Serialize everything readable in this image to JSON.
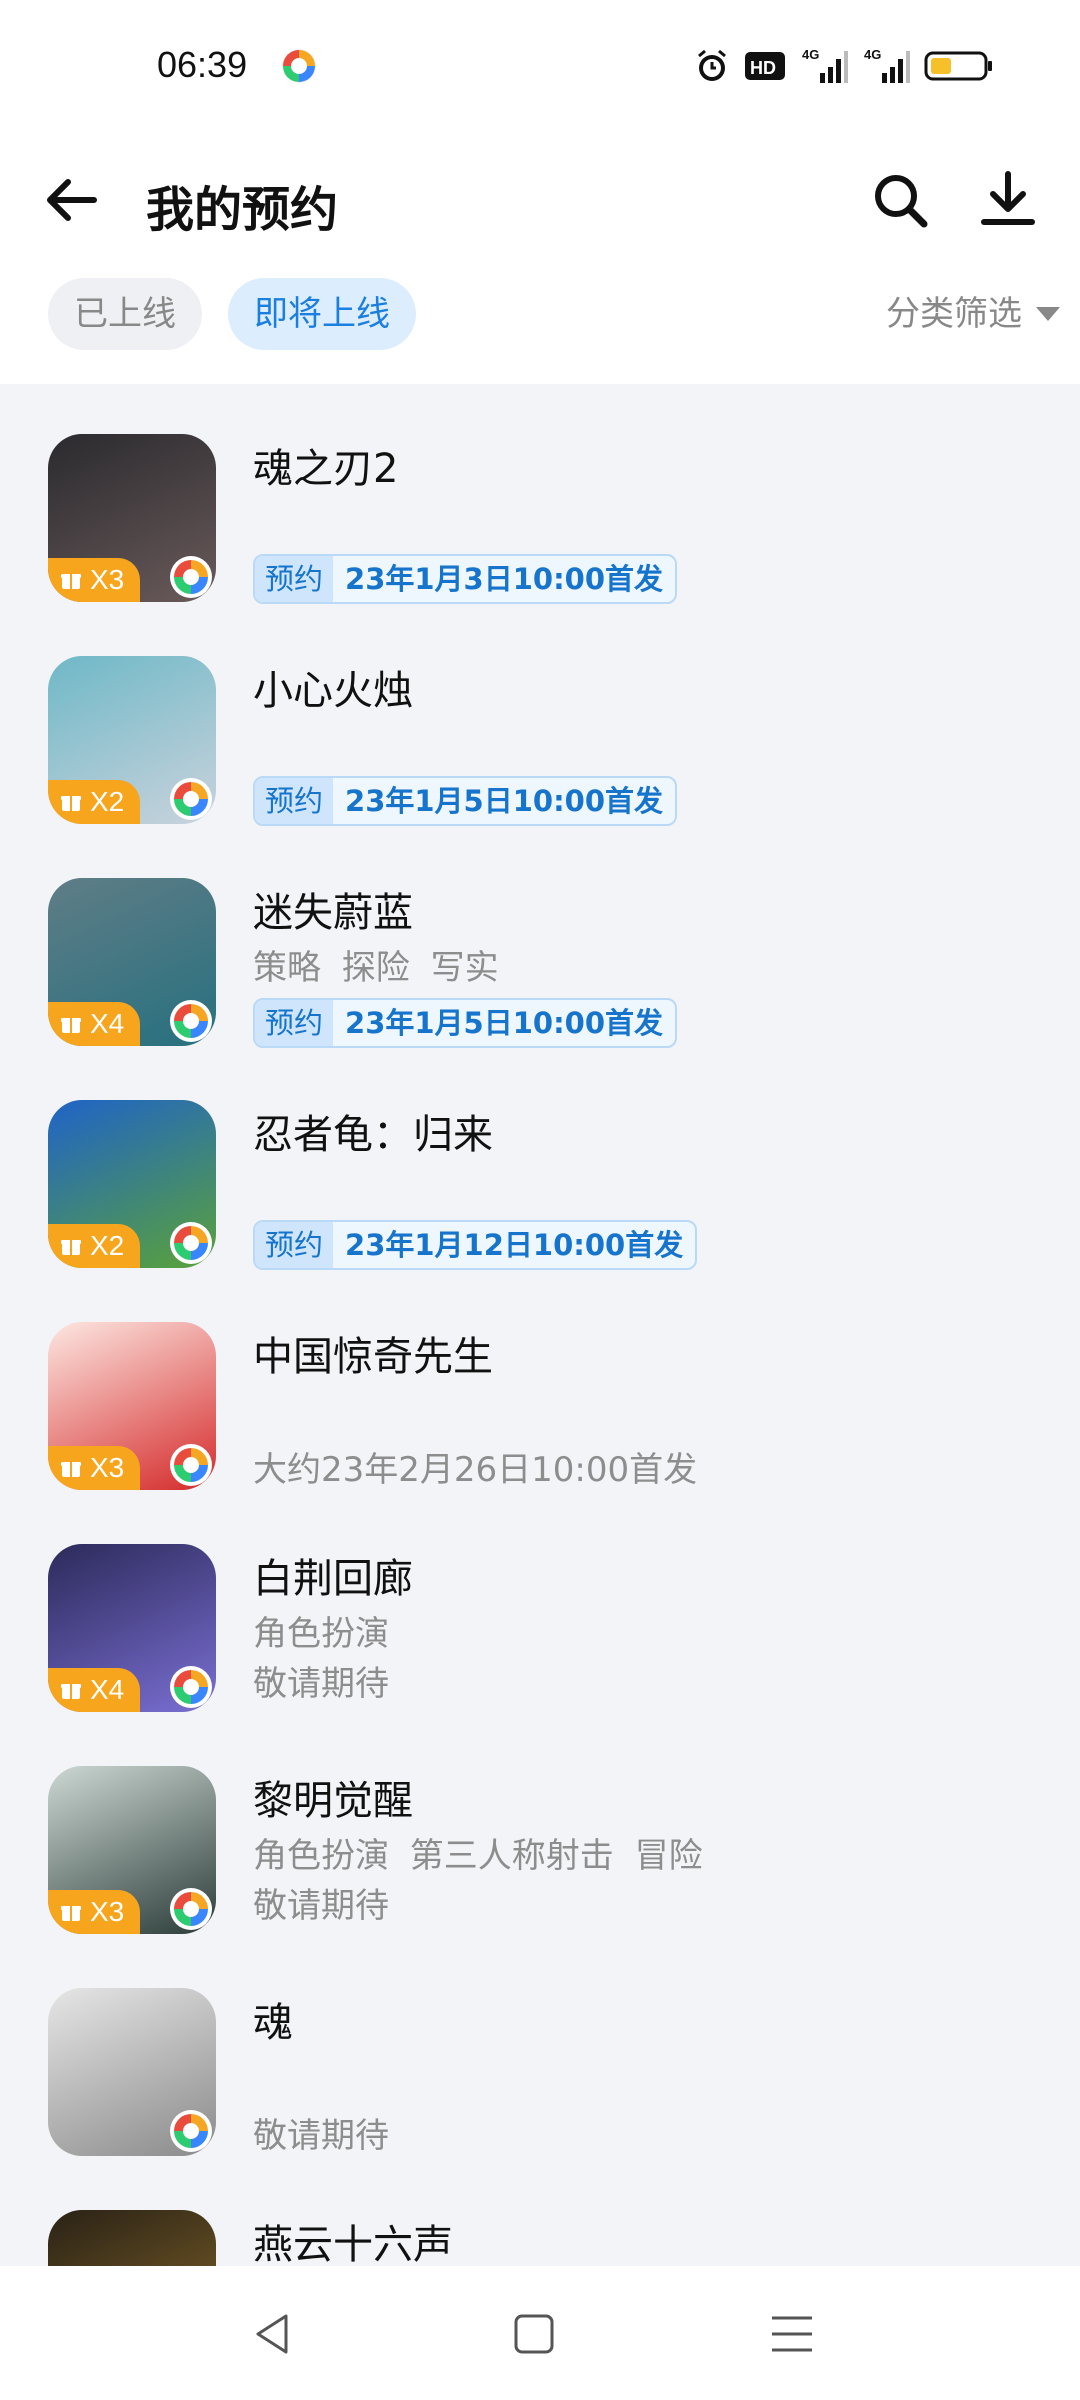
{
  "status_bar": {
    "time": "06:39",
    "icons": [
      "alarm-icon",
      "hd-icon",
      "4g-signal-icon",
      "4g-signal-icon",
      "battery-icon"
    ],
    "signal_labels": [
      "4G",
      "4G"
    ],
    "hd_label": "HD"
  },
  "header": {
    "title": "我的预约",
    "back_icon": "back-arrow-icon",
    "search_icon": "search-icon",
    "download_icon": "download-icon"
  },
  "tabs": [
    {
      "label": "已上线",
      "active": false
    },
    {
      "label": "即将上线",
      "active": true
    }
  ],
  "filter": {
    "label": "分类筛选",
    "icon": "triangle-down-icon"
  },
  "games": [
    {
      "name": "魂之刃2",
      "gift": "X3",
      "tags": "",
      "release_tag": "预约",
      "release_date": "23年1月3日10:00首发",
      "release_text": "",
      "colors": [
        "#2a2a2e",
        "#6a5a5a"
      ]
    },
    {
      "name": "小心火烛",
      "gift": "X2",
      "tags": "",
      "release_tag": "预约",
      "release_date": "23年1月5日10:00首发",
      "release_text": "",
      "colors": [
        "#6fb8c7",
        "#c9d3dc"
      ]
    },
    {
      "name": "迷失蔚蓝",
      "gift": "X4",
      "tags": "策略 探险 写实",
      "release_tag": "预约",
      "release_date": "23年1月5日10:00首发",
      "release_text": "",
      "colors": [
        "#5f7d86",
        "#27707f"
      ]
    },
    {
      "name": "忍者龟：归来",
      "gift": "X2",
      "tags": "",
      "release_tag": "预约",
      "release_date": "23年1月12日10:00首发",
      "release_text": "",
      "colors": [
        "#1f63c8",
        "#5aa23a"
      ]
    },
    {
      "name": "中国惊奇先生",
      "gift": "X3",
      "tags": "",
      "release_tag": "",
      "release_date": "",
      "release_text": "大约23年2月26日10:00首发",
      "colors": [
        "#fde7e2",
        "#d42a2a"
      ]
    },
    {
      "name": "白荆回廊",
      "gift": "X4",
      "tags": "角色扮演",
      "release_tag": "",
      "release_date": "",
      "release_text": "敬请期待",
      "colors": [
        "#2c2a5a",
        "#7a6fd3"
      ]
    },
    {
      "name": "黎明觉醒",
      "gift": "X3",
      "tags": "角色扮演 第三人称射击 冒险",
      "release_tag": "",
      "release_date": "",
      "release_text": "敬请期待",
      "colors": [
        "#cdd8d3",
        "#2b3c39"
      ]
    },
    {
      "name": "魂",
      "gift": "",
      "tags": "",
      "release_tag": "",
      "release_date": "",
      "release_text": "敬请期待",
      "colors": [
        "#e6e6e6",
        "#8a8a8a"
      ]
    },
    {
      "name": "燕云十六声",
      "gift": "",
      "tags": "",
      "release_tag": "",
      "release_date": "",
      "release_text": "",
      "colors": [
        "#2a2216",
        "#8a6a2a"
      ]
    }
  ],
  "nav_bar": {
    "icons": [
      "back-triangle-icon",
      "home-square-icon",
      "menu-lines-icon"
    ]
  }
}
